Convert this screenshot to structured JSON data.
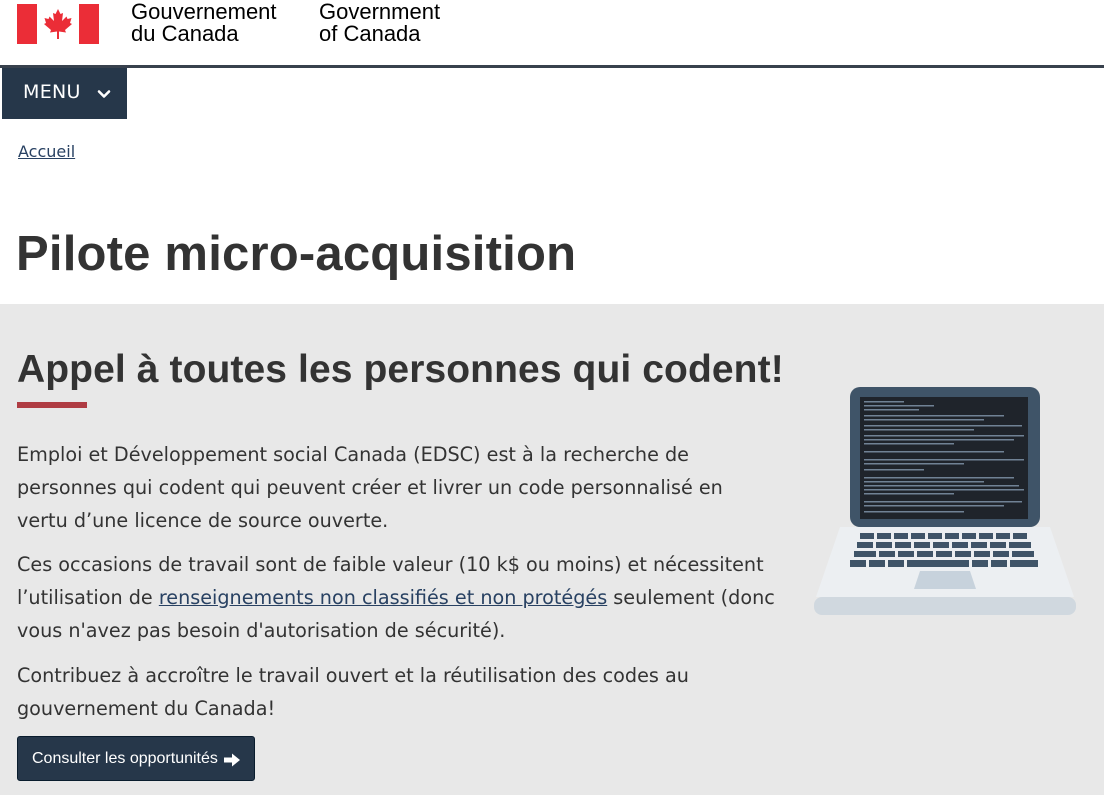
{
  "header": {
    "signature_fr_line1": "Gouvernement",
    "signature_fr_line2": "du Canada",
    "signature_en_line1": "Government",
    "signature_en_line2": "of Canada"
  },
  "menu": {
    "label": "MENU"
  },
  "breadcrumb": {
    "items": [
      {
        "label": "Accueil"
      }
    ]
  },
  "page": {
    "title": "Pilote micro-acquisition"
  },
  "feature": {
    "heading": "Appel à toutes les personnes qui codent!",
    "paragraph1": "Emploi et Développement social Canada (EDSC) est à la recherche de personnes qui codent qui peuvent créer et livrer un code personnalisé en vertu d’une licence de source ouverte.",
    "paragraph2_before": "Ces occasions de travail sont de faible valeur (10 k$ ou moins) et nécessitent l’utilisation de ",
    "paragraph2_link": "renseignements non classifiés et non protégés",
    "paragraph2_after": " seulement (donc vous n'avez pas besoin d'autorisation de sécurité).",
    "paragraph3": "Contribuez à accroître le travail ouvert et la réutilisation des codes au gouvernement du Canada!",
    "cta_label": "Consulter les opportunités"
  },
  "colors": {
    "flag_red": "#eb2d37",
    "nav_dark": "#26374a",
    "link": "#284162",
    "accent_bar": "#af3c43",
    "band_bg": "#e8e8e8"
  },
  "icons": [
    "canada-flag-icon",
    "chevron-down-icon",
    "arrow-right-icon",
    "laptop-illustration"
  ]
}
